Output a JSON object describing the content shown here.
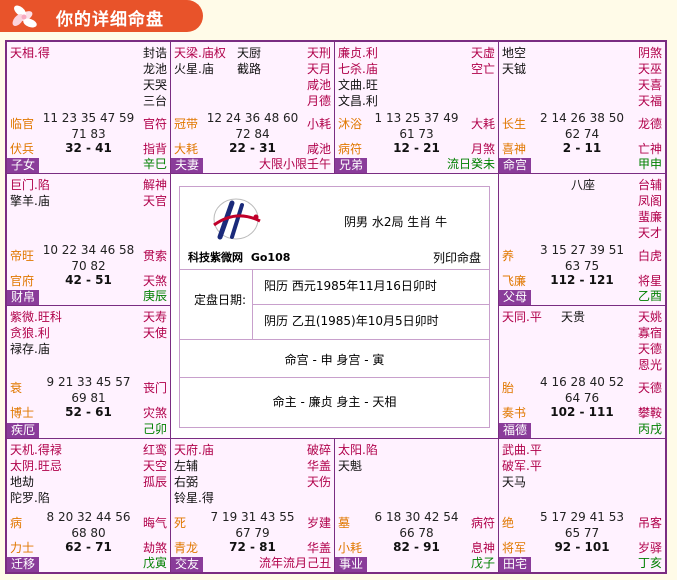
{
  "header": {
    "title": "你的详细命盘"
  },
  "center": {
    "site_name": "科技紫微网",
    "site_code": "Go108",
    "gender_info": "阴男 水2局 生肖 牛",
    "print_label": "列印命盘",
    "date_label": "定盘日期:",
    "solar": "阳历 西元1985年11月16日卯时",
    "lunar": "阴历 乙丑(1985)年10月5日卯时",
    "palaces": "命宫 - 申  身宫 - 寅",
    "masters": "命主 - 廉贞  身主 - 天相"
  },
  "cells": {
    "c0": {
      "left": [
        "天相.得"
      ],
      "right": [
        "封诰",
        "龙池",
        "天哭",
        "三台"
      ],
      "nums1": "11 23 35 47 59",
      "nums2": "71 83",
      "bl1": "临官",
      "br1": "官符",
      "bl2": "伏兵",
      "br2": "指背",
      "age": "32 - 41",
      "palace": "子女",
      "gz": "辛巳"
    },
    "c1": {
      "left": [
        "天梁.庙权",
        "火星.庙"
      ],
      "mid": [
        "天厨",
        "截路"
      ],
      "right": [
        "天刑",
        "天月",
        "咸池",
        "月德"
      ],
      "nums1": "12 24 36 48 60",
      "nums2": "72 84",
      "bl1": "冠带",
      "br1": "小耗",
      "bl2": "大耗",
      "br2": "咸池",
      "age": "22 - 31",
      "palace": "夫妻",
      "gz": "大限小限壬午"
    },
    "c2": {
      "left": [
        "廉贞.利",
        "七杀.庙",
        "文曲.旺",
        "文昌.利"
      ],
      "right": [
        "天虚",
        "空亡"
      ],
      "nums1": "1 13 25 37 49",
      "nums2": "61 73",
      "bl1": "沐浴",
      "br1": "大耗",
      "bl2": "病符",
      "br2": "月煞",
      "age": "12 - 21",
      "palace": "兄弟",
      "gz": "流日癸未"
    },
    "c3": {
      "left": [
        "地空",
        "天钺"
      ],
      "right": [
        "阴煞",
        "天巫",
        "天喜",
        "天福"
      ],
      "nums1": "2 14 26 38 50",
      "nums2": "62 74",
      "bl1": "长生",
      "br1": "龙德",
      "bl2": "喜神",
      "br2": "亡神",
      "age": "2 - 11",
      "palace": "命宫",
      "gz": "甲申"
    },
    "c4": {
      "left": [
        "巨门.陷",
        "擎羊.庙"
      ],
      "right": [
        "解神",
        "天官"
      ],
      "nums1": "10 22 34 46 58",
      "nums2": "70 82",
      "bl1": "帝旺",
      "br1": "贯索",
      "bl2": "官府",
      "br2": "天煞",
      "age": "42 - 51",
      "palace": "财帛",
      "gz": "庚辰"
    },
    "c5": {
      "left": [],
      "mid": [
        "八座"
      ],
      "right": [
        "台辅",
        "凤阁",
        "蜚廉",
        "天才"
      ],
      "nums1": "3 15 27 39 51",
      "nums2": "63 75",
      "bl1": "养",
      "br1": "白虎",
      "bl2": "飞廉",
      "br2": "将星",
      "age": "112 - 121",
      "palace": "父母",
      "gz": "乙酉"
    },
    "c6": {
      "left": [
        "紫微.旺科",
        "贪狼.利",
        "禄存.庙"
      ],
      "right": [
        "天寿",
        "天使"
      ],
      "nums1": "9 21 33 45 57",
      "nums2": "69 81",
      "bl1": "衰",
      "br1": "丧门",
      "bl2": "博士",
      "br2": "灾煞",
      "age": "52 - 61",
      "palace": "疾厄",
      "gz": "己卯"
    },
    "c7": {
      "left": [
        "天同.平"
      ],
      "mid": [
        "天贵"
      ],
      "right": [
        "天姚",
        "寡宿",
        "天德",
        "恩光"
      ],
      "nums1": "4 16 28 40 52",
      "nums2": "64 76",
      "bl1": "胎",
      "br1": "天德",
      "bl2": "奏书",
      "br2": "攀鞍",
      "age": "102 - 111",
      "palace": "福德",
      "gz": "丙戌"
    },
    "c8": {
      "left": [
        "天机.得禄",
        "太阴.旺忌",
        "地劫",
        "陀罗.陷"
      ],
      "right": [
        "红鸾",
        "天空",
        "孤辰"
      ],
      "nums1": "8 20 32 44 56",
      "nums2": "68 80",
      "bl1": "病",
      "br1": "晦气",
      "bl2": "力士",
      "br2": "劫煞",
      "age": "62 - 71",
      "palace": "迁移",
      "gz": "戊寅"
    },
    "c9": {
      "left": [
        "天府.庙",
        "左辅",
        "右弼",
        "铃星.得"
      ],
      "right": [
        "破碎",
        "华盖",
        "天伤"
      ],
      "nums1": "7 19 31 43 55",
      "nums2": "67 79",
      "bl1": "死",
      "br1": "岁建",
      "bl2": "青龙",
      "br2": "华盖",
      "age": "72 - 81",
      "palace": "交友",
      "gz": "流年流月己丑"
    },
    "c10": {
      "left": [
        "太阳.陷",
        "天魁"
      ],
      "right": [],
      "nums1": "6 18 30 42 54",
      "nums2": "66 78",
      "bl1": "墓",
      "br1": "病符",
      "bl2": "小耗",
      "br2": "息神",
      "age": "82 - 91",
      "palace": "事业",
      "gz": "戊子"
    },
    "c11": {
      "left": [
        "武曲.平",
        "破军.平",
        "天马"
      ],
      "right": [],
      "nums1": "5 17 29 41 53",
      "nums2": "65 77",
      "bl1": "绝",
      "br1": "吊客",
      "bl2": "将军",
      "br2": "岁驿",
      "age": "92 - 101",
      "palace": "田宅",
      "gz": "丁亥"
    }
  }
}
